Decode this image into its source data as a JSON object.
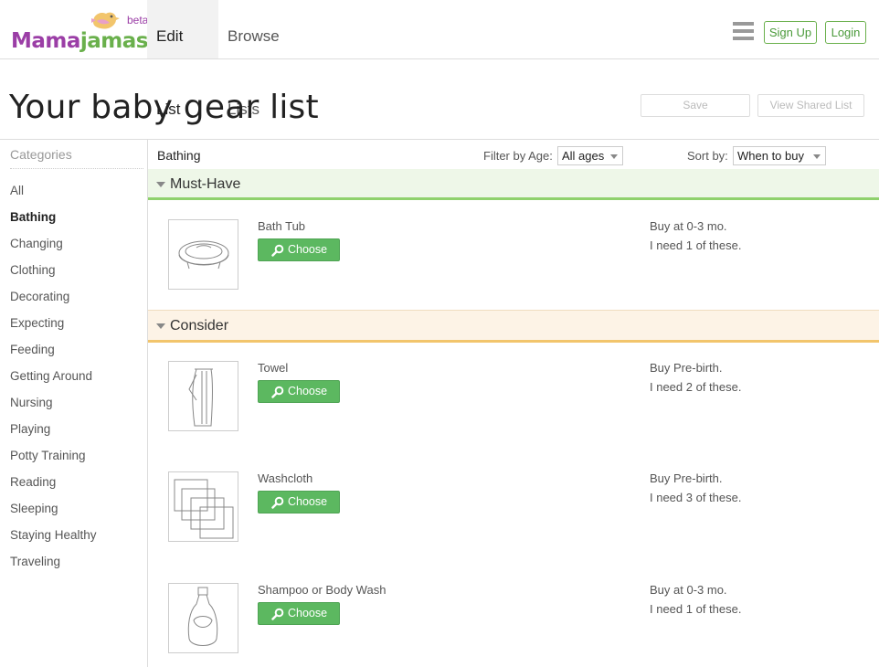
{
  "header": {
    "logo_part1": "Mama",
    "logo_part2": "jamas",
    "beta": "beta",
    "tabs": [
      {
        "label": "Edit List",
        "active": true
      },
      {
        "label": "Browse Lists",
        "active": false
      }
    ],
    "signup": "Sign Up",
    "login": "Login"
  },
  "title": {
    "text": "Your baby gear list",
    "save": "Save",
    "view_shared": "View Shared List"
  },
  "sidebar": {
    "heading": "Categories",
    "items": [
      {
        "label": "All"
      },
      {
        "label": "Bathing",
        "active": true
      },
      {
        "label": "Changing"
      },
      {
        "label": "Clothing"
      },
      {
        "label": "Decorating"
      },
      {
        "label": "Expecting"
      },
      {
        "label": "Feeding"
      },
      {
        "label": "Getting Around"
      },
      {
        "label": "Nursing"
      },
      {
        "label": "Playing"
      },
      {
        "label": "Potty Training"
      },
      {
        "label": "Reading"
      },
      {
        "label": "Sleeping"
      },
      {
        "label": "Staying Healthy"
      },
      {
        "label": "Traveling"
      }
    ]
  },
  "toolbar": {
    "category": "Bathing",
    "filter_label": "Filter by Age:",
    "filter_value": "All ages",
    "sort_label": "Sort by:",
    "sort_value": "When to buy"
  },
  "sections": [
    {
      "title": "Must-Have",
      "items": [
        {
          "name": "Bath Tub",
          "icon": "bath-tub-icon",
          "buy": "Buy at 0-3 mo.",
          "need": "I need 1 of these.",
          "choose": "Choose"
        }
      ]
    },
    {
      "title": "Consider",
      "items": [
        {
          "name": "Towel",
          "icon": "towel-icon",
          "buy": "Buy Pre-birth.",
          "need": "I need 2 of these.",
          "choose": "Choose"
        },
        {
          "name": "Washcloth",
          "icon": "washcloth-icon",
          "buy": "Buy Pre-birth.",
          "need": "I need 3 of these.",
          "choose": "Choose"
        },
        {
          "name": "Shampoo or Body Wash",
          "icon": "shampoo-bottle-icon",
          "buy": "Buy at 0-3 mo.",
          "need": "I need 1 of these.",
          "choose": "Choose"
        }
      ]
    }
  ],
  "colors": {
    "brand_purple": "#9b3ea6",
    "brand_green": "#6ab04c",
    "choose_button": "#5cb860",
    "must_have_bg": "#eef7e8",
    "consider_bg": "#fdf3e6"
  }
}
